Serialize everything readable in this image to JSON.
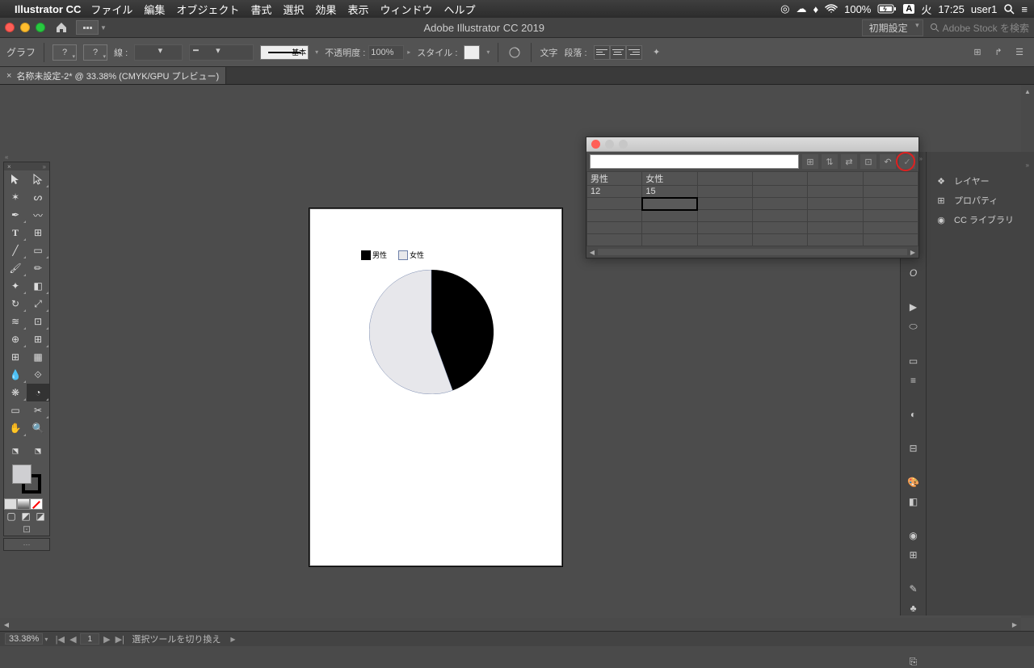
{
  "menubar": {
    "app_name": "Illustrator CC",
    "items": [
      "ファイル",
      "編集",
      "オブジェクト",
      "書式",
      "選択",
      "効果",
      "表示",
      "ウィンドウ",
      "ヘルプ"
    ],
    "battery": "100%",
    "day": "火",
    "time": "17:25",
    "user": "user1",
    "input_badge": "A"
  },
  "app_chrome": {
    "title": "Adobe Illustrator CC 2019",
    "preset": "初期設定",
    "search_placeholder": "Adobe Stock を検索"
  },
  "control_bar": {
    "tool_label": "グラフ",
    "stroke_label": "線 :",
    "brush_label": "基本",
    "opacity_label": "不透明度 :",
    "opacity_value": "100%",
    "style_label": "スタイル :",
    "text_label": "文字",
    "para_label": "段落 :"
  },
  "doc_tab": {
    "label": "名称未設定-2* @ 33.38% (CMYK/GPU プレビュー)"
  },
  "chart_data": {
    "type": "pie",
    "categories": [
      "男性",
      "女性"
    ],
    "values": [
      12,
      15
    ],
    "colors": [
      "#000000",
      "#e7e7eb"
    ],
    "legend_position": "top"
  },
  "data_panel": {
    "input_value": "",
    "header_row": [
      "男性",
      "女性"
    ],
    "value_row": [
      "12",
      "15"
    ]
  },
  "right_panels": {
    "layers": "レイヤー",
    "properties": "プロパティ",
    "cc_lib": "CC ライブラリ"
  },
  "statusbar": {
    "zoom": "33.38%",
    "artboard_index": "1",
    "hint": "選択ツールを切り換え"
  }
}
